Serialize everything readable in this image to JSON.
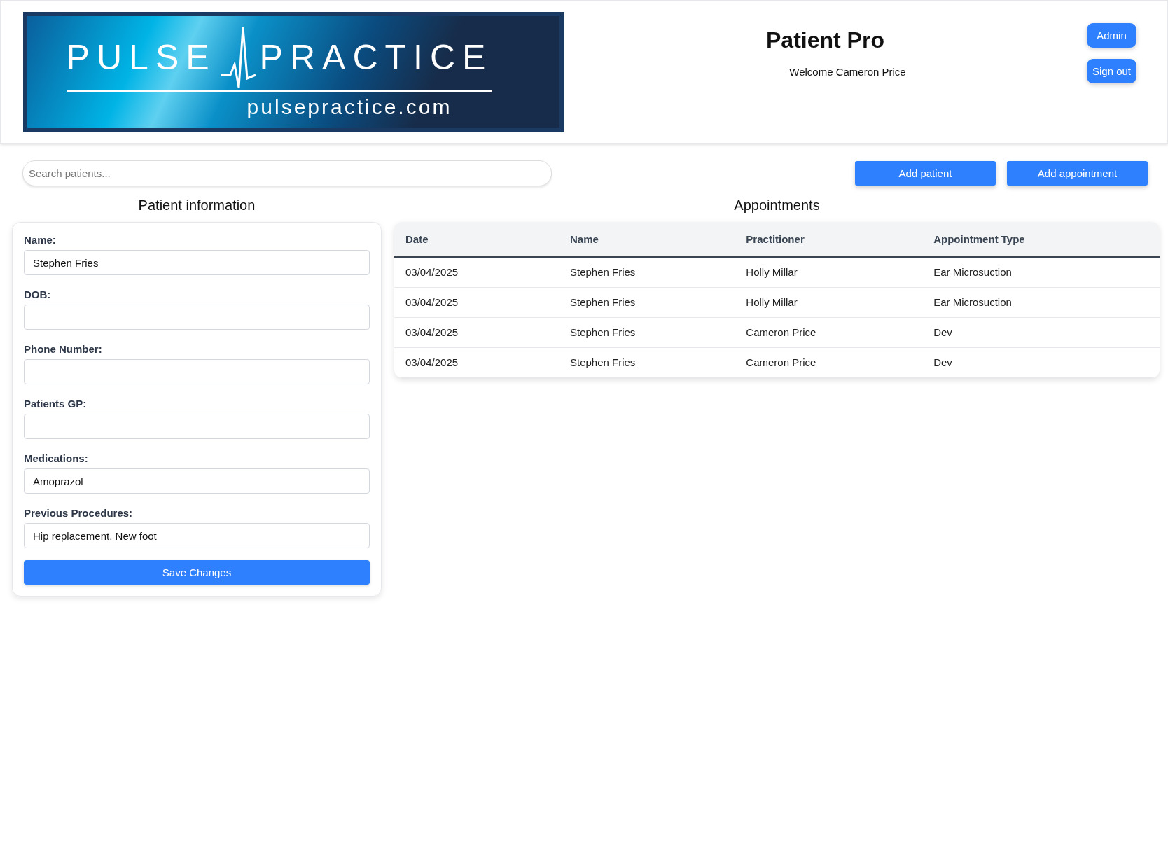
{
  "header": {
    "logo": {
      "brand": "PULSE",
      "brand_2": "PRACTICE",
      "domain": "pulsepractice.com"
    },
    "title": "Patient Pro",
    "welcome": "Welcome Cameron Price",
    "buttons": [
      "Admin",
      "Sign out"
    ]
  },
  "toolbar": {
    "search": {
      "placeholder": "Search patients..."
    },
    "buttons": [
      "Add patient",
      "Add appointment"
    ]
  },
  "patient_information": {
    "heading": "Patient information",
    "fields": [
      {
        "label": "Name:",
        "value": "Stephen Fries"
      },
      {
        "label": "DOB:"
      },
      {
        "label": "Phone Number:"
      },
      {
        "label": "Patients GP:"
      },
      {
        "label": "Medications:",
        "value": "Amoprazol"
      },
      {
        "label": "Previous Procedures:",
        "value": "Hip replacement, New foot"
      }
    ],
    "save_button": "Save Changes"
  },
  "appointments": {
    "heading": "Appointments",
    "columns": [
      "Date",
      "Name",
      "Practitioner",
      "Appointment Type"
    ],
    "rows": [
      [
        "03/04/2025",
        "Stephen Fries",
        "Holly Millar",
        "Ear Microsuction"
      ],
      [
        "03/04/2025",
        "Stephen Fries",
        "Holly Millar",
        "Ear Microsuction"
      ],
      [
        "03/04/2025",
        "Stephen Fries",
        "Cameron Price",
        "Dev"
      ],
      [
        "03/04/2025",
        "Stephen Fries",
        "Cameron Price",
        "Dev"
      ]
    ]
  }
}
